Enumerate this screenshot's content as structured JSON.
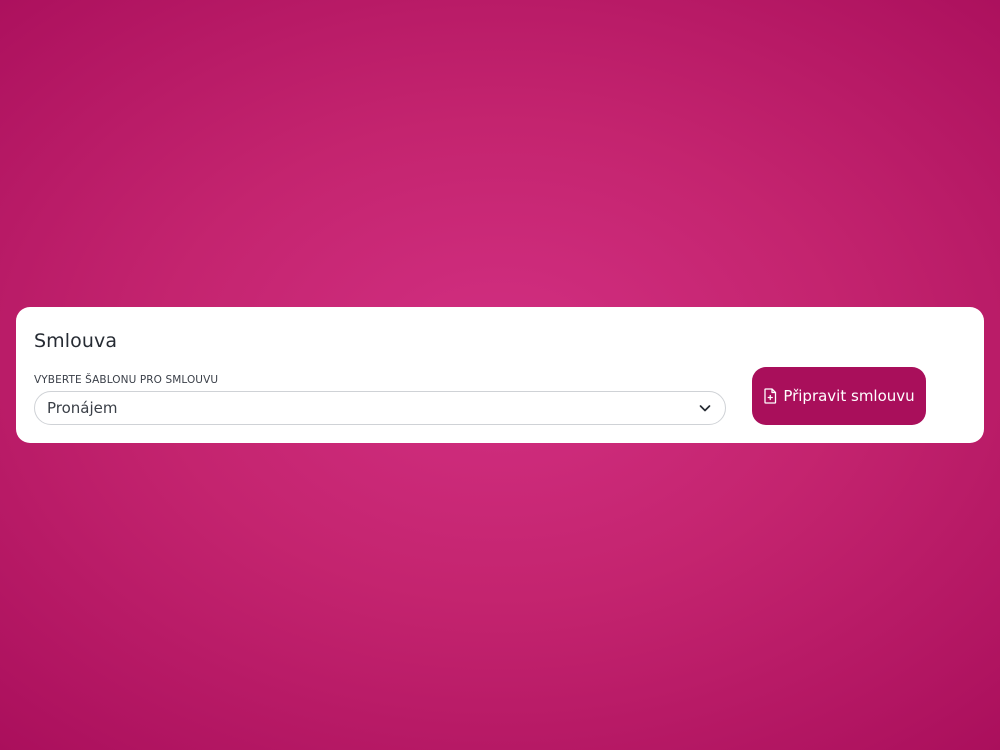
{
  "card": {
    "title": "Smlouva",
    "template_select": {
      "label": "VYBERTE ŠABLONU PRO SMLOUVU",
      "selected_value": "Pronájem",
      "icon": "chevron-down-icon"
    },
    "prepare_button": {
      "label": "Připravit smlouvu",
      "icon": "file-plus-icon"
    }
  },
  "colors": {
    "background_center": "#d22f82",
    "background_edge": "#aa0f5c",
    "card_background": "#ffffff",
    "button_background": "#a90f5b",
    "button_text": "#ffffff",
    "input_border": "#cfd2d6"
  }
}
